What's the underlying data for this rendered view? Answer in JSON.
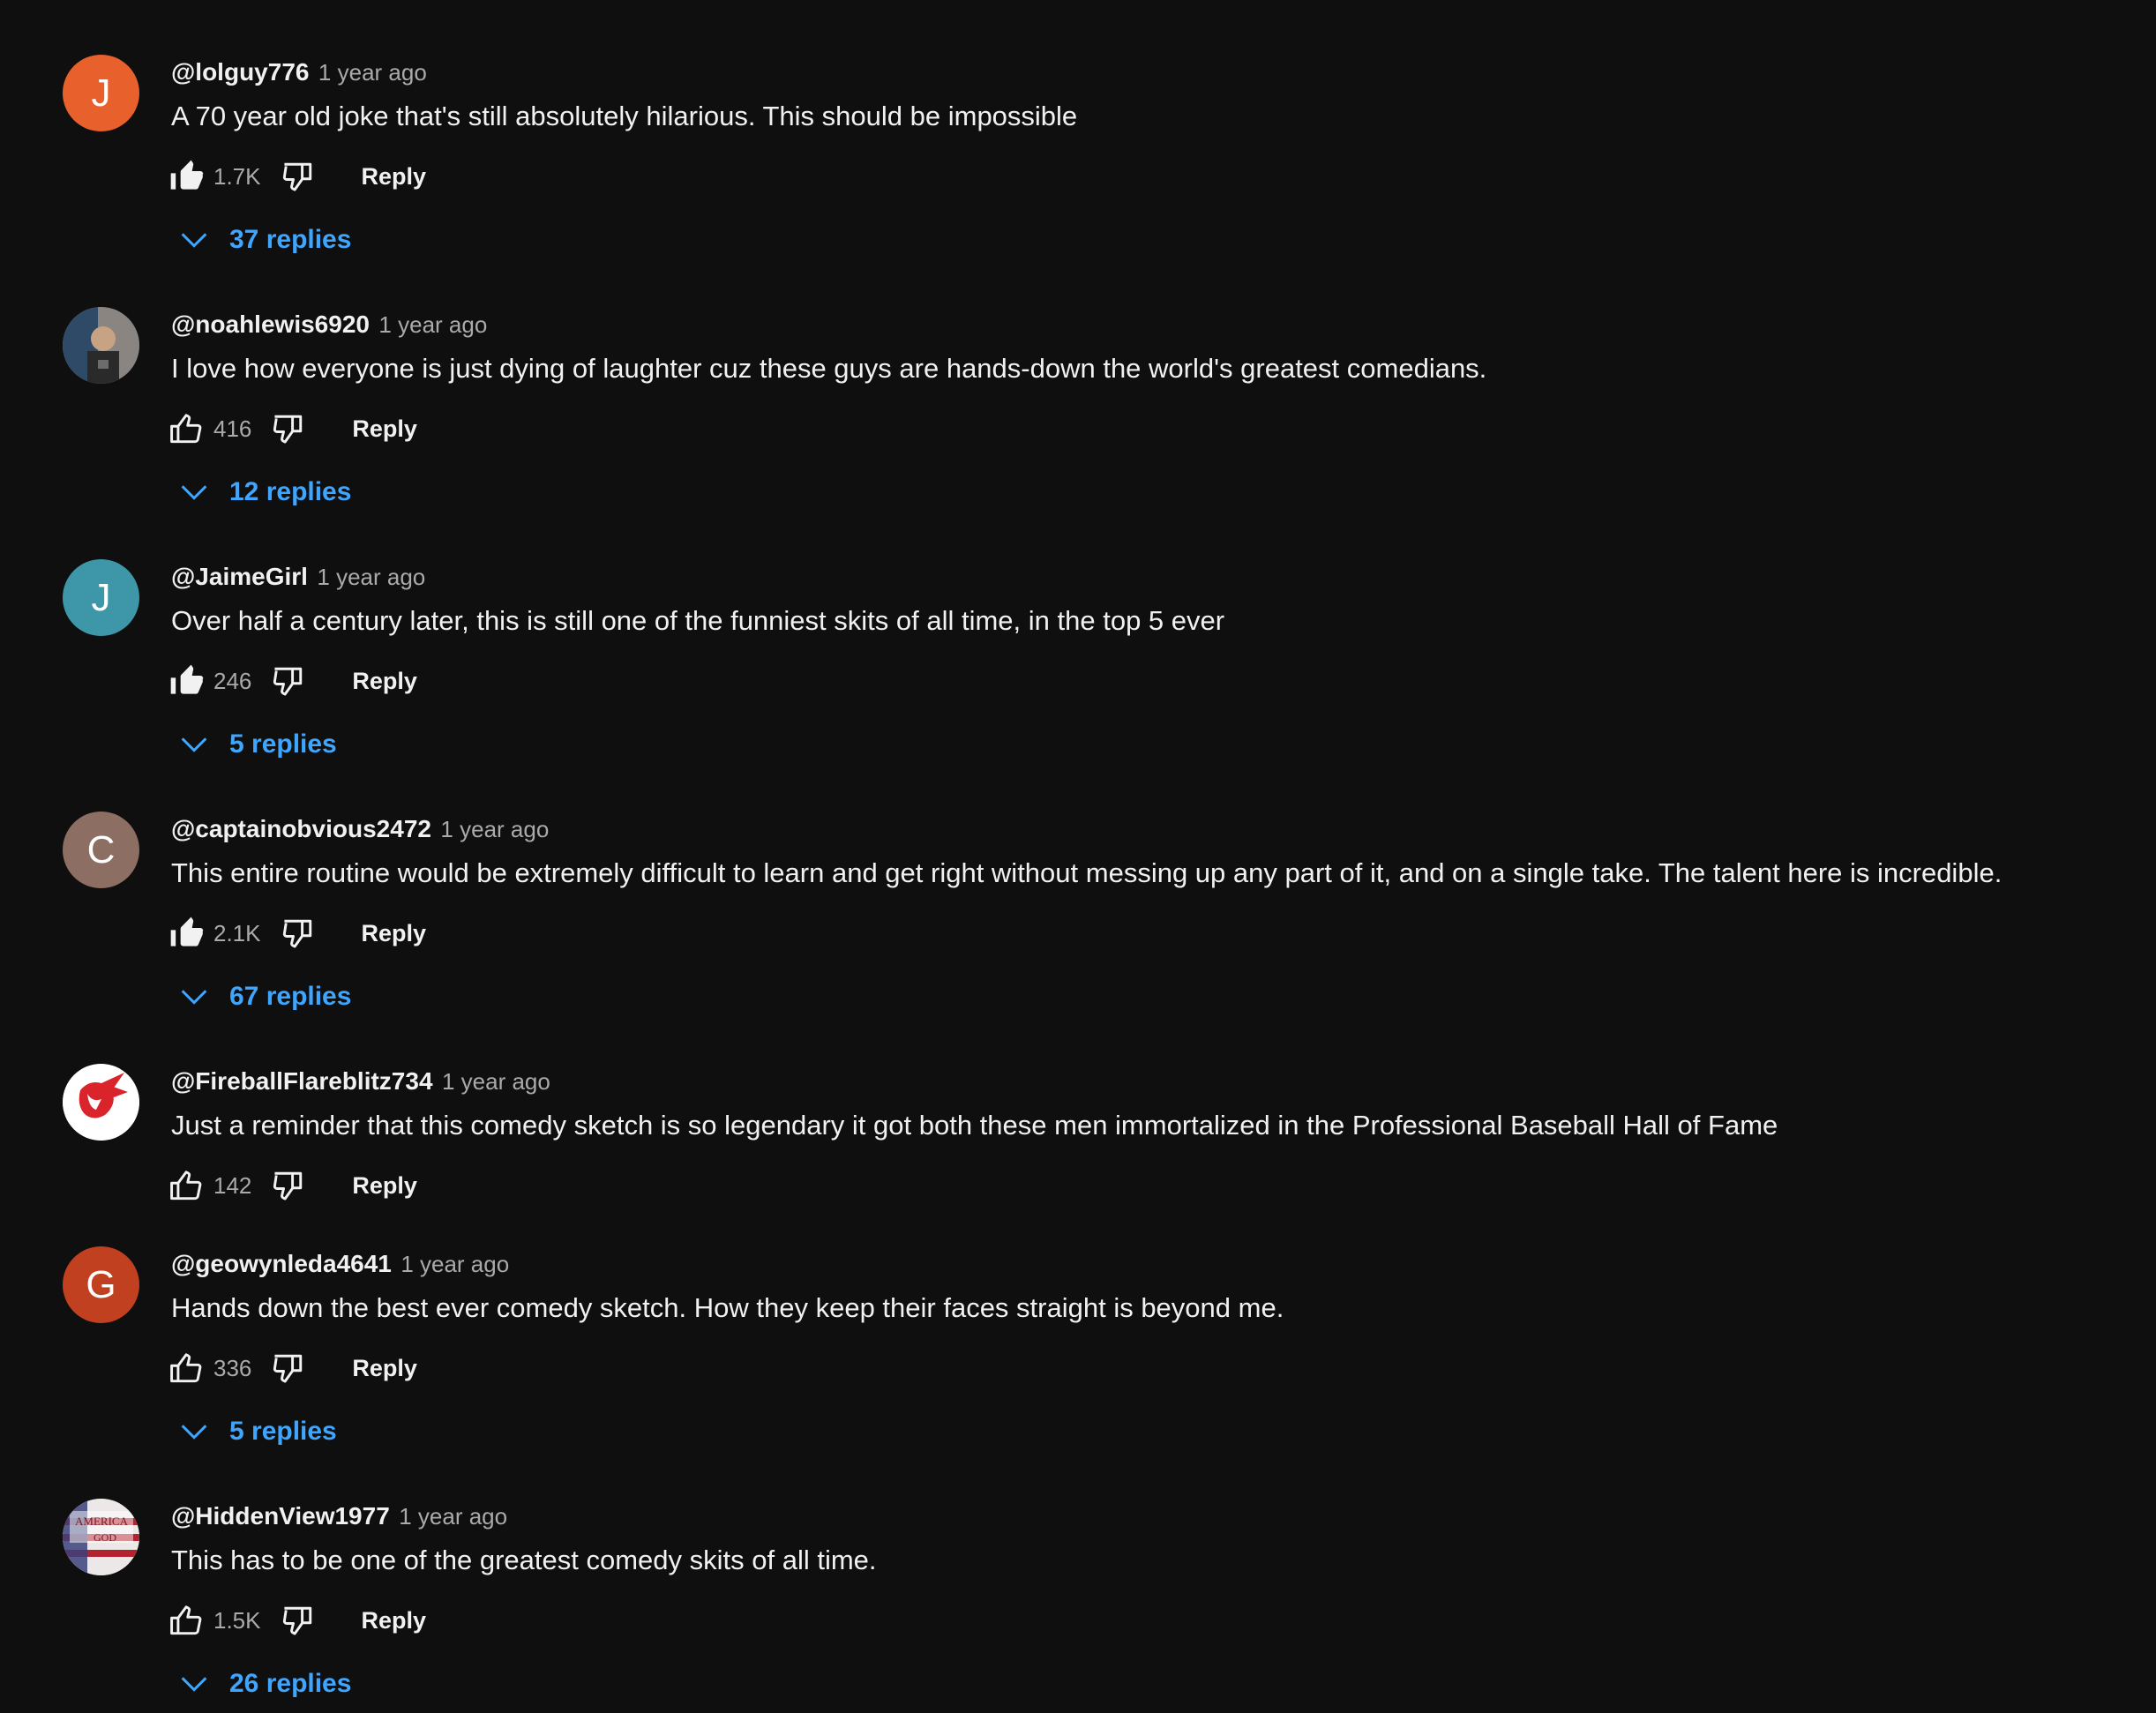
{
  "comments": [
    {
      "author": "@lolguy776",
      "time": "1 year ago",
      "text": "A 70 year old joke that's still absolutely hilarious. This should be impossible",
      "likes": "1.7K",
      "reply_label": "Reply",
      "replies_label": "37 replies",
      "avatar_letter": "J",
      "avatar_color": "#e8602c",
      "liked": true
    },
    {
      "author": "@noahlewis6920",
      "time": "1 year ago",
      "text": "I love how everyone is just dying of laughter cuz these guys are hands-down the world's greatest comedians.",
      "likes": "416",
      "reply_label": "Reply",
      "replies_label": "12 replies",
      "avatar_letter": "",
      "avatar_color": "#5a5450",
      "liked": false
    },
    {
      "author": "@JaimeGirl",
      "time": "1 year ago",
      "text": "Over half a century later, this is still one of the funniest skits of all time, in the top 5 ever",
      "likes": "246",
      "reply_label": "Reply",
      "replies_label": "5 replies",
      "avatar_letter": "J",
      "avatar_color": "#3e97a8",
      "liked": true
    },
    {
      "author": "@captainobvious2472",
      "time": "1 year ago",
      "text": "This entire routine would be extremely difficult to learn and get right without messing up any part of it, and on a single take. The talent here is incredible.",
      "likes": "2.1K",
      "reply_label": "Reply",
      "replies_label": "67 replies",
      "avatar_letter": "C",
      "avatar_color": "#8d6e63",
      "liked": true
    },
    {
      "author": "@FireballFlareblitz734",
      "time": "1 year ago",
      "text": "Just a reminder that this comedy sketch is so legendary it got both these men immortalized in the Professional Baseball Hall of Fame",
      "likes": "142",
      "reply_label": "Reply",
      "replies_label": "",
      "avatar_letter": "",
      "avatar_color": "#ffffff",
      "liked": false
    },
    {
      "author": "@geowynleda4641",
      "time": "1 year ago",
      "text": "Hands down the best ever comedy sketch.  How they keep their faces straight is beyond me.",
      "likes": "336",
      "reply_label": "Reply",
      "replies_label": "5 replies",
      "avatar_letter": "G",
      "avatar_color": "#c1401f",
      "liked": false
    },
    {
      "author": "@HiddenView1977",
      "time": "1 year ago",
      "text": "This has to be one of the greatest comedy skits of all time.",
      "likes": "1.5K",
      "reply_label": "Reply",
      "replies_label": "26 replies",
      "avatar_letter": "",
      "avatar_color": "#e8e4e4",
      "avatar_text_top": "AMERICA",
      "avatar_text_bottom": "GOD",
      "liked": false
    }
  ],
  "icons": {
    "like": "thumb-up-icon",
    "dislike": "thumb-down-icon",
    "expand": "chevron-down-icon"
  },
  "colors": {
    "background": "#0f0f0f",
    "text": "#f1f1f1",
    "secondary": "#aaaaaa",
    "link": "#3ea6ff"
  }
}
